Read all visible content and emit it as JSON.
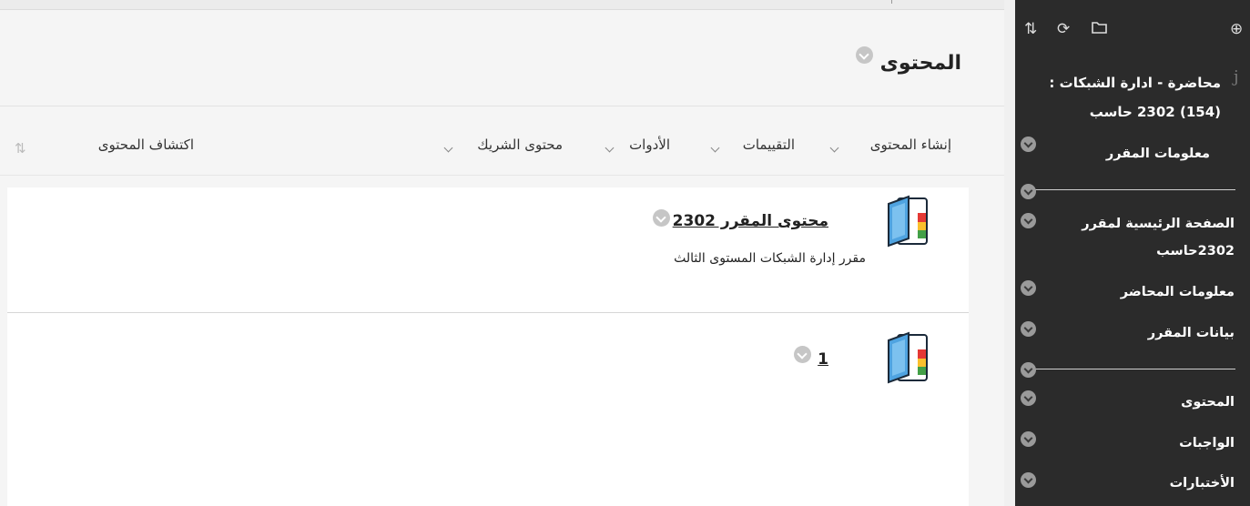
{
  "page": {
    "title": "المحتوى"
  },
  "toolbar": {
    "build_content": "إنشاء المحتوى",
    "assessments": "التقييمات",
    "tools": "الأدوات",
    "partner_content": "محتوى الشريك",
    "discover_content": "اكتشاف المحتوى"
  },
  "items": [
    {
      "title": "محتوى المقرر 2302",
      "description": "مقرر إدارة الشبكات المستوى الثالث"
    },
    {
      "title": "1",
      "description": ""
    }
  ],
  "sidebar": {
    "course_title_line1": "محاضرة - ادارة الشبكات :",
    "course_title_line2": "(154) 2302 حاسب",
    "items": [
      {
        "label": "معلومات المقرر"
      },
      {
        "label": "الصفحة الرئيسية لمقرر"
      },
      {
        "label": "2302حاسب"
      },
      {
        "label": "معلومات المحاضر"
      },
      {
        "label": "بيانات المقرر"
      },
      {
        "label": "المحتوى"
      },
      {
        "label": "الواجبات"
      },
      {
        "label": "الأختبارات"
      }
    ]
  }
}
